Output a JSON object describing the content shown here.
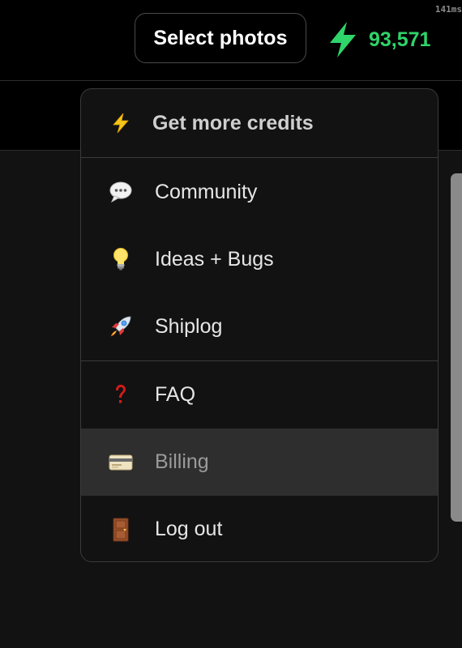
{
  "debug": {
    "timing": "141ms"
  },
  "header": {
    "select_photos_label": "Select photos",
    "credits_value": "93,571",
    "credits_icon": "lightning-bolt-icon",
    "credits_color": "#2fd46a"
  },
  "menu": {
    "items": [
      {
        "label": "Get more credits",
        "icon": "lightning-icon"
      },
      {
        "label": "Community",
        "icon": "speech-bubble-icon"
      },
      {
        "label": "Ideas + Bugs",
        "icon": "light-bulb-icon"
      },
      {
        "label": "Shiplog",
        "icon": "rocket-icon"
      },
      {
        "label": "FAQ",
        "icon": "question-mark-icon"
      },
      {
        "label": "Billing",
        "icon": "credit-card-icon"
      },
      {
        "label": "Log out",
        "icon": "door-icon"
      }
    ],
    "highlighted_item": "Billing"
  }
}
